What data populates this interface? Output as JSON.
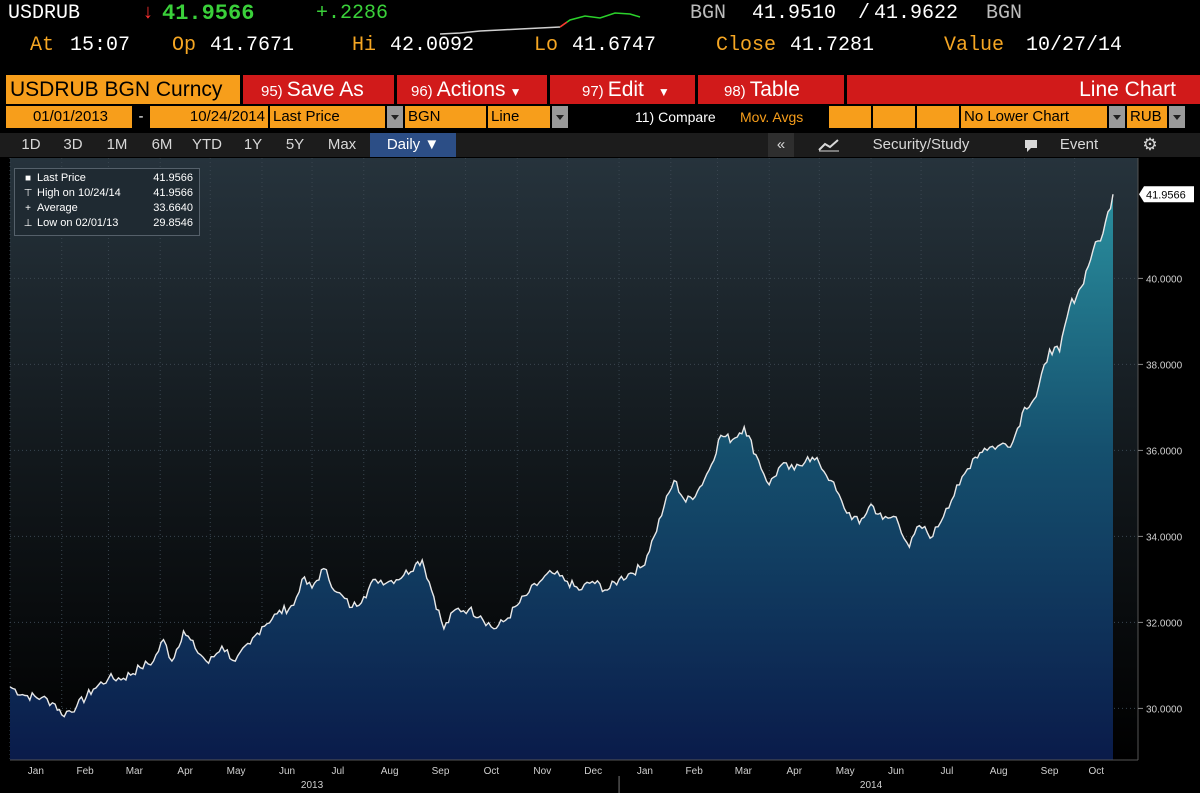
{
  "quote": {
    "ticker": "USDRUB",
    "arrow": "↓",
    "last": "41.9566",
    "change": "+.2286",
    "source": "BGN",
    "bid": "41.9510",
    "slash": "/",
    "ask": "41.9622",
    "source2": "BGN",
    "at_label": "At",
    "at_value": "15:07",
    "op_label": "Op",
    "op_value": "41.7671",
    "hi_label": "Hi",
    "hi_value": "42.0092",
    "lo_label": "Lo",
    "lo_value": "41.6747",
    "close_label": "Close",
    "close_value": "41.7281",
    "value_label": "Value",
    "value_date": "10/27/14"
  },
  "command_bar": {
    "security": "USDRUB BGN Curncy",
    "buttons": [
      {
        "num": "95)",
        "label": "Save As"
      },
      {
        "num": "96)",
        "label": "Actions"
      },
      {
        "num": "97)",
        "label": "Edit"
      },
      {
        "num": "98)",
        "label": "Table"
      }
    ],
    "view_title": "Line Chart"
  },
  "controls": {
    "start_date": "01/01/2013",
    "dash": "-",
    "end_date": "10/24/2014",
    "field": "Last Price",
    "source": "BGN",
    "style": "Line",
    "compare": "11) Compare",
    "studies": "Mov. Avgs",
    "lower_chart": "No Lower Chart",
    "currency": "RUB"
  },
  "tabs": {
    "periods": [
      "1D",
      "3D",
      "1M",
      "6M",
      "YTD",
      "1Y",
      "5Y",
      "Max"
    ],
    "frequency": "Daily ▼",
    "collapse": "«",
    "security_study": "Security/Study",
    "event": "Event",
    "gear": "⚙"
  },
  "legend": {
    "rows": [
      {
        "label": "Last Price",
        "value": "41.9566"
      },
      {
        "label": "High on 10/24/14",
        "value": "41.9566"
      },
      {
        "label": "Average",
        "value": "33.6640"
      },
      {
        "label": "Low on 02/01/13",
        "value": "29.8546"
      }
    ]
  },
  "colors": {
    "line": "#e8e8e8",
    "area_top": "#2a8f9e",
    "area_bottom": "#0a1b4a",
    "bg_top": "#26333c",
    "bg_bottom": "#000000",
    "red_button": "#d11a1a",
    "orange": "#f79e1b",
    "tab_selected": "#2c4e86"
  },
  "chart_data": {
    "type": "area",
    "title": "",
    "xlabel": "",
    "ylabel": "",
    "ylim": [
      28.8,
      42.8
    ],
    "y_ticks": [
      "30.0000",
      "32.0000",
      "34.0000",
      "36.0000",
      "38.0000",
      "40.0000"
    ],
    "last_label": "41.9566",
    "x_month_labels": [
      "Jan",
      "Feb",
      "Mar",
      "Apr",
      "May",
      "Jun",
      "Jul",
      "Aug",
      "Sep",
      "Oct",
      "Nov",
      "Dec",
      "Jan",
      "Feb",
      "Mar",
      "Apr",
      "May",
      "Jun",
      "Jul",
      "Aug",
      "Sep",
      "Oct"
    ],
    "x_year_labels": [
      "2013",
      "2014"
    ],
    "series": [
      {
        "values": [
          [
            "2013-01-01",
            30.5
          ],
          [
            "2013-01-10",
            30.3
          ],
          [
            "2013-01-20",
            30.25
          ],
          [
            "2013-01-28",
            30.1
          ],
          [
            "2013-02-01",
            29.85
          ],
          [
            "2013-02-10",
            30.05
          ],
          [
            "2013-02-20",
            30.45
          ],
          [
            "2013-03-01",
            30.7
          ],
          [
            "2013-03-10",
            30.7
          ],
          [
            "2013-03-20",
            30.95
          ],
          [
            "2013-03-28",
            31.1
          ],
          [
            "2013-04-03",
            31.6
          ],
          [
            "2013-04-08",
            31.1
          ],
          [
            "2013-04-15",
            31.8
          ],
          [
            "2013-04-22",
            31.4
          ],
          [
            "2013-04-30",
            31.05
          ],
          [
            "2013-05-08",
            31.45
          ],
          [
            "2013-05-16",
            31.1
          ],
          [
            "2013-05-25",
            31.5
          ],
          [
            "2013-06-01",
            31.9
          ],
          [
            "2013-06-10",
            32.2
          ],
          [
            "2013-06-20",
            32.4
          ],
          [
            "2013-06-25",
            33.0
          ],
          [
            "2013-07-01",
            32.8
          ],
          [
            "2013-07-08",
            33.25
          ],
          [
            "2013-07-16",
            32.7
          ],
          [
            "2013-07-25",
            32.35
          ],
          [
            "2013-08-01",
            32.6
          ],
          [
            "2013-08-08",
            33.0
          ],
          [
            "2013-08-16",
            32.95
          ],
          [
            "2013-08-25",
            33.1
          ],
          [
            "2013-09-01",
            33.35
          ],
          [
            "2013-09-05",
            33.45
          ],
          [
            "2013-09-12",
            32.6
          ],
          [
            "2013-09-18",
            31.85
          ],
          [
            "2013-09-25",
            32.3
          ],
          [
            "2013-10-03",
            32.3
          ],
          [
            "2013-10-10",
            32.15
          ],
          [
            "2013-10-18",
            31.85
          ],
          [
            "2013-10-25",
            32.05
          ],
          [
            "2013-11-01",
            32.4
          ],
          [
            "2013-11-08",
            32.7
          ],
          [
            "2013-11-16",
            33.0
          ],
          [
            "2013-11-22",
            33.15
          ],
          [
            "2013-12-01",
            32.95
          ],
          [
            "2013-12-08",
            32.75
          ],
          [
            "2013-12-16",
            32.95
          ],
          [
            "2013-12-25",
            32.75
          ],
          [
            "2014-01-01",
            33.0
          ],
          [
            "2014-01-08",
            33.15
          ],
          [
            "2014-01-15",
            33.3
          ],
          [
            "2014-01-22",
            34.0
          ],
          [
            "2014-01-28",
            34.7
          ],
          [
            "2014-02-03",
            35.3
          ],
          [
            "2014-02-10",
            34.8
          ],
          [
            "2014-02-17",
            35.05
          ],
          [
            "2014-02-24",
            35.55
          ],
          [
            "2014-03-03",
            36.35
          ],
          [
            "2014-03-10",
            36.25
          ],
          [
            "2014-03-17",
            36.55
          ],
          [
            "2014-03-24",
            35.9
          ],
          [
            "2014-04-01",
            35.2
          ],
          [
            "2014-04-08",
            35.65
          ],
          [
            "2014-04-16",
            35.55
          ],
          [
            "2014-04-24",
            35.85
          ],
          [
            "2014-05-01",
            35.7
          ],
          [
            "2014-05-08",
            35.3
          ],
          [
            "2014-05-16",
            34.65
          ],
          [
            "2014-05-25",
            34.3
          ],
          [
            "2014-06-01",
            34.75
          ],
          [
            "2014-06-08",
            34.4
          ],
          [
            "2014-06-16",
            34.45
          ],
          [
            "2014-06-24",
            33.75
          ],
          [
            "2014-06-30",
            34.25
          ],
          [
            "2014-07-08",
            34.0
          ],
          [
            "2014-07-16",
            34.65
          ],
          [
            "2014-07-24",
            35.2
          ],
          [
            "2014-08-01",
            35.8
          ],
          [
            "2014-08-08",
            36.05
          ],
          [
            "2014-08-16",
            36.1
          ],
          [
            "2014-08-25",
            36.2
          ],
          [
            "2014-09-01",
            37.0
          ],
          [
            "2014-09-08",
            37.25
          ],
          [
            "2014-09-16",
            38.35
          ],
          [
            "2014-09-22",
            38.3
          ],
          [
            "2014-09-28",
            39.35
          ],
          [
            "2014-10-05",
            39.8
          ],
          [
            "2014-10-12",
            40.65
          ],
          [
            "2014-10-18",
            41.05
          ],
          [
            "2014-10-24",
            41.9566
          ]
        ]
      }
    ]
  }
}
